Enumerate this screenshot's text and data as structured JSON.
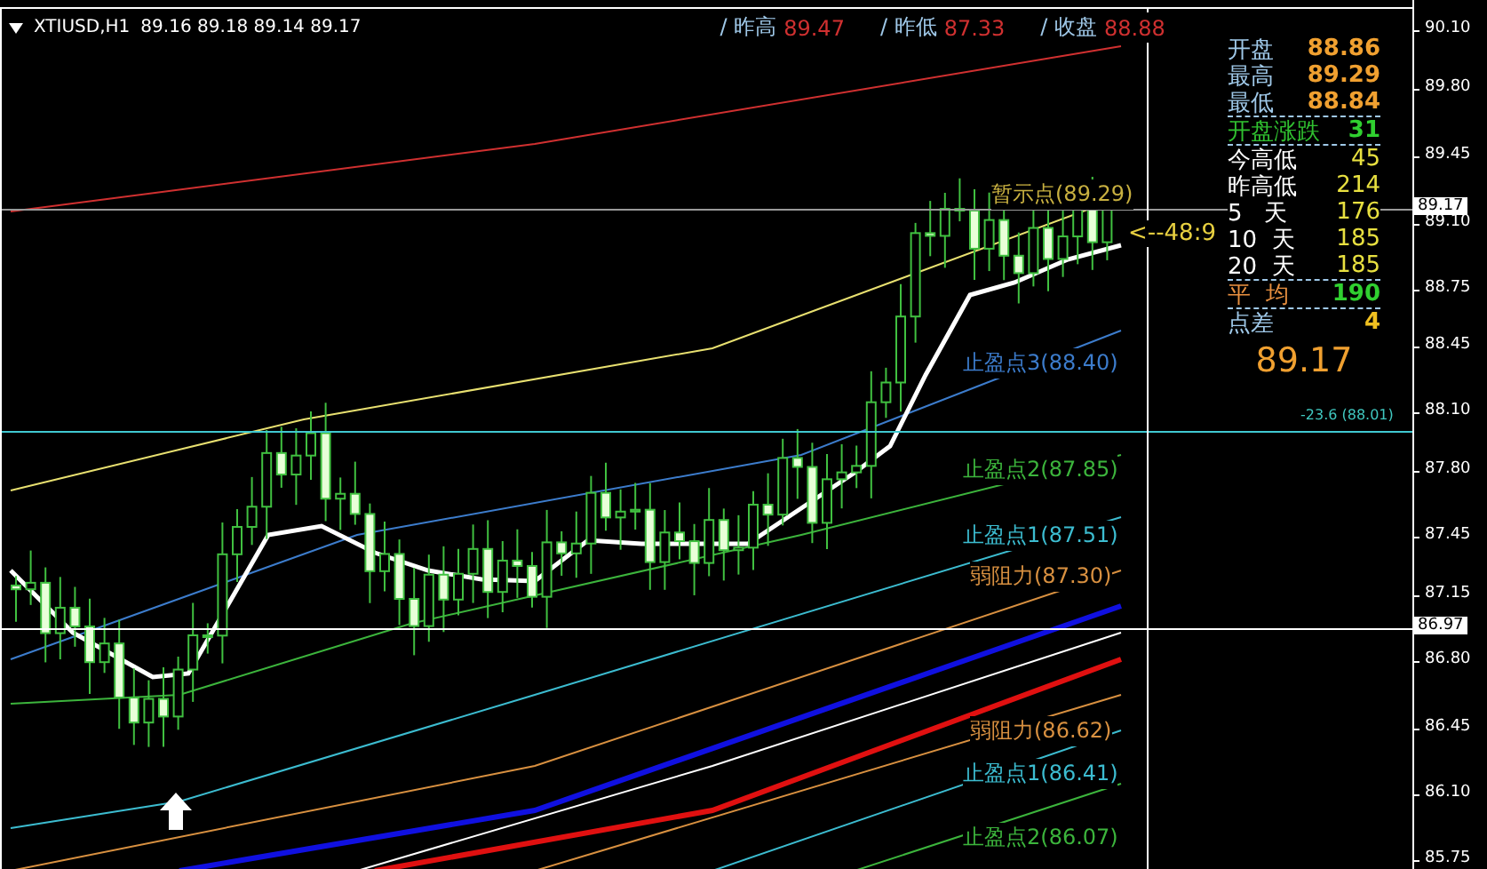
{
  "header": {
    "symbol": "XTIUSD,H1",
    "ohlc": "89.16 89.18 89.14 89.17",
    "stats": [
      {
        "label": "/ 昨高",
        "value": "89.47"
      },
      {
        "label": "/ 昨低",
        "value": "87.33"
      },
      {
        "label": "/ 收盘",
        "value": "88.88"
      }
    ]
  },
  "info_panel": {
    "rows": [
      {
        "kind": "price",
        "label": "开盘",
        "value": "88.86"
      },
      {
        "kind": "price",
        "label": "最高",
        "value": "89.29"
      },
      {
        "kind": "price",
        "label": "最低",
        "value": "88.84"
      },
      {
        "kind": "change",
        "label": "开盘涨跌",
        "value": "31"
      },
      {
        "kind": "range",
        "label": "今高低",
        "value": "45"
      },
      {
        "kind": "range",
        "label": "昨高低",
        "value": "214"
      },
      {
        "kind": "range",
        "label": "5   天",
        "value": "176"
      },
      {
        "kind": "range",
        "label": "10  天",
        "value": "185"
      },
      {
        "kind": "range",
        "label": "20  天",
        "value": "185"
      },
      {
        "kind": "average",
        "label": "平  均",
        "value": "190"
      },
      {
        "kind": "spread",
        "label": "点差",
        "value": "4"
      }
    ],
    "last_price": "89.17"
  },
  "chart": {
    "level_labels": [
      {
        "text": "暂示点(89.29)",
        "color": "#c8b040"
      },
      {
        "text": "止盈点3(88.40)",
        "color": "#3c7ccc"
      },
      {
        "text": "止盈点2(87.85)",
        "color": "#3cb43c"
      },
      {
        "text": "止盈点1(87.51)",
        "color": "#3cbcd0"
      },
      {
        "text": "弱阻力(87.30)",
        "color": "#d89040"
      },
      {
        "text": "弱阻力(86.62)",
        "color": "#d89040"
      },
      {
        "text": "止盈点1(86.41)",
        "color": "#3cbcd0"
      },
      {
        "text": "止盈点2(86.07)",
        "color": "#3cb43c"
      }
    ],
    "distance_label": "<--48:9",
    "fib_label": "-23.6 (88.01)"
  },
  "price_axis": {
    "ticks": [
      "90.10",
      "89.80",
      "89.45",
      "89.10",
      "88.75",
      "88.45",
      "88.10",
      "87.80",
      "87.45",
      "87.15",
      "86.80",
      "86.45",
      "86.10",
      "85.75"
    ],
    "markers": [
      {
        "kind": "bid",
        "value": "89.17"
      },
      {
        "kind": "cursor",
        "value": "86.97"
      }
    ]
  }
}
